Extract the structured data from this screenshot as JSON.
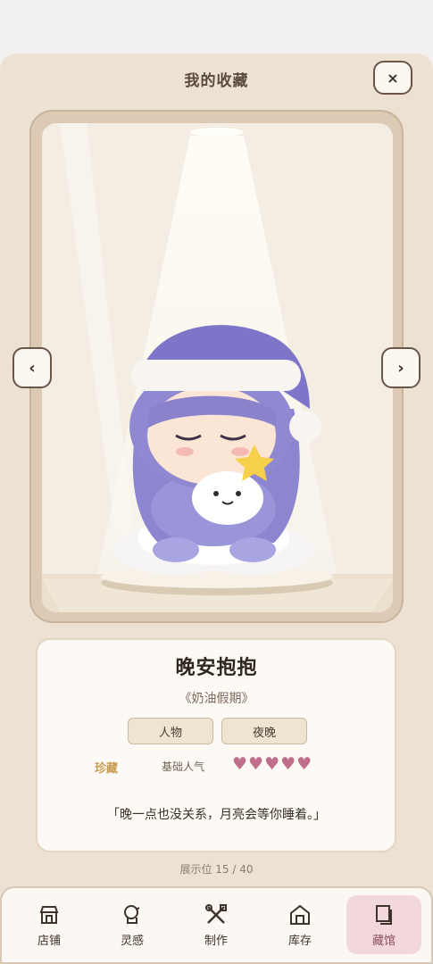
{
  "header": {
    "title": "我的收藏",
    "close_label": "×"
  },
  "nav": {
    "prev_label": "‹",
    "next_label": "›"
  },
  "item": {
    "name": "晚安抱抱",
    "series": "《奶油假期》",
    "tags": [
      "人物",
      "夜晚"
    ],
    "rarity": "珍藏",
    "popularity_label": "基础人气",
    "hearts_text": "♥♥♥♥♥",
    "hearts_count": 5,
    "quote": "「晚一点也没关系，月亮会等你睡着。」"
  },
  "slot": "展示位 15 / 40",
  "tabs": [
    {
      "label": "店铺",
      "icon": "shop-icon"
    },
    {
      "label": "灵感",
      "icon": "idea-icon"
    },
    {
      "label": "制作",
      "icon": "tools-icon"
    },
    {
      "label": "库存",
      "icon": "warehouse-icon"
    },
    {
      "label": "藏馆",
      "icon": "gallery-icon",
      "active": true
    }
  ],
  "colors": {
    "accent": "#bf6f8c",
    "active_tab_bg": "#f2d7dc",
    "gold": "#c79a52",
    "figure_purple": "#8c85cf"
  }
}
